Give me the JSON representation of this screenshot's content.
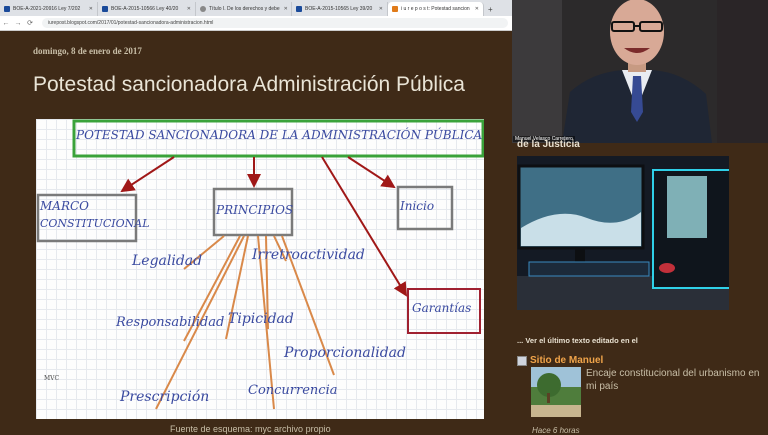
{
  "browser": {
    "tabs": [
      {
        "label": "BOE-A-2021-20916 Ley 7/202",
        "active": false
      },
      {
        "label": "BOE-A-2015-10566 Ley 40/20",
        "active": false
      },
      {
        "label": "Título I. De los derechos y debe",
        "active": false
      },
      {
        "label": "BOE-A-2015-10565 Ley 39/20",
        "active": false
      },
      {
        "label": "i u r e p o s t: Potestad sancion",
        "active": true
      }
    ],
    "new_tab": "+",
    "url": "iurepost.blogspot.com/2017/01/potestad-sancionadora-administracion.html"
  },
  "post": {
    "date": "domingo, 8 de enero de 2017",
    "title": "Potestad sancionadora Administración Pública",
    "caption": "Fuente de esquema: myc archivo propio"
  },
  "scheme": {
    "top": "POTESTAD SANCIONADORA DE LA ADMINISTRACIÓN PÚBLICA",
    "marco": "MARCO",
    "constitucional": "CONSTITUCIONAL",
    "principios": "PRINCIPIOS",
    "inicio": "Inicio",
    "garantias": "Garantías",
    "legalidad": "Legalidad",
    "irretroactividad": "Irretroactividad",
    "responsabilidad": "Responsabilidad",
    "tipicidad": "Tipicidad",
    "proporcionalidad": "Proporcionalidad",
    "prescripcion": "Prescripción",
    "concurrencia": "Concurrencia",
    "signature": "MVC"
  },
  "video": {
    "participant": "Manuel Velasco Carretero"
  },
  "sidebar": {
    "section_title": "de la Justicia",
    "last_edit_heading": "... Ver el último texto editado en el",
    "site_name": "Sitio de Manuel",
    "post_link": "Encaje constitucional del urbanismo en mi país",
    "ago": "Hace 6 horas"
  },
  "colors": {
    "page_bg": "#3f2a17",
    "box_green": "#3aa23a",
    "box_gray": "#7a7a7a",
    "box_red": "#a02030",
    "arrow_red": "#a01818",
    "arrow_orange": "#d9894a",
    "ink_blue": "#3a4aa0",
    "link_orange": "#f0a44a"
  }
}
